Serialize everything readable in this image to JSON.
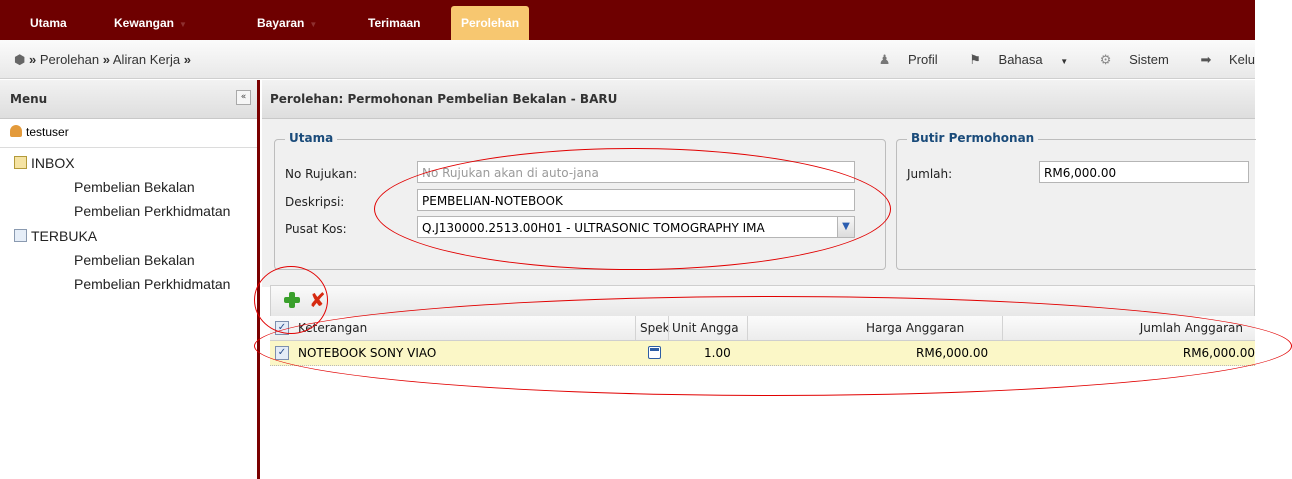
{
  "nav": {
    "tabs": [
      {
        "label": "Utama"
      },
      {
        "label": "Kewangan"
      },
      {
        "label": "Bayaran"
      },
      {
        "label": "Terimaan"
      },
      {
        "label": "Perolehan",
        "active": true
      }
    ]
  },
  "breadcrumb": {
    "items": [
      "Perolehan",
      "Aliran Kerja"
    ],
    "sep": "»"
  },
  "usermenu": {
    "profil": "Profil",
    "bahasa": "Bahasa",
    "sistem": "Sistem",
    "keluar": "Kelu"
  },
  "sidebar": {
    "title": "Menu",
    "collapse": "«",
    "user": "testuser",
    "groups": [
      {
        "label": "INBOX",
        "items": [
          "Pembelian Bekalan",
          "Pembelian Perkhidmatan"
        ]
      },
      {
        "label": "TERBUKA",
        "items": [
          "Pembelian Bekalan",
          "Pembelian Perkhidmatan"
        ]
      }
    ]
  },
  "main": {
    "title": "Perolehan: Permohonan Pembelian Bekalan - BARU",
    "utama": {
      "legend": "Utama",
      "no_rujukan_label": "No Rujukan:",
      "no_rujukan_placeholder": "No Rujukan akan di auto-jana",
      "deskripsi_label": "Deskripsi:",
      "deskripsi_value": "PEMBELIAN-NOTEBOOK",
      "pusat_kos_label": "Pusat Kos:",
      "pusat_kos_value": "Q.J130000.2513.00H01 - ULTRASONIC TOMOGRAPHY IMA"
    },
    "butir": {
      "legend": "Butir Permohonan",
      "jumlah_label": "Jumlah:",
      "jumlah_value": "RM6,000.00"
    },
    "grid": {
      "headers": {
        "keterangan": "Keterangan",
        "spek": "Spek",
        "unit": "Unit Angga",
        "harga": "Harga Anggaran",
        "jumlah": "Jumlah Anggaran"
      },
      "rows": [
        {
          "keterangan": "NOTEBOOK SONY VIAO",
          "unit": "1.00",
          "harga": "RM6,000.00",
          "jumlah": "RM6,000.00"
        }
      ]
    }
  },
  "colors": {
    "nav_bg": "#6e0000",
    "active_tab": "#f7c770",
    "row_highlight": "#fbf7c7",
    "annotation": "#e10000"
  }
}
